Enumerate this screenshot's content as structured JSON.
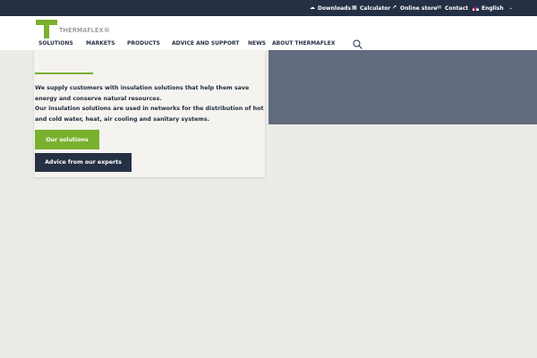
{
  "topbar": {
    "downloads": "Downloads",
    "calculator": "Calculator",
    "online_store": "Online store",
    "contact": "Contact",
    "language": "English"
  },
  "brand": {
    "name": "THERMAFLEX®",
    "green": "#79b12e",
    "navy": "#263044"
  },
  "nav": {
    "items": [
      {
        "label": "SOLUTIONS"
      },
      {
        "label": "MARKETS"
      },
      {
        "label": "PRODUCTS"
      },
      {
        "label": "ADVICE AND SUPPORT"
      },
      {
        "label": "NEWS"
      },
      {
        "label": "ABOUT THERMAFLEX"
      }
    ]
  },
  "hero": {
    "line1": "We supply customers with insulation solutions that help them save energy and conserve natural resources.",
    "line2": "Our insulation solutions are used in networks for the distribution of hot and cold water, heat, air cooling and sanitary systems.",
    "primary_cta": "Our solutions",
    "secondary_cta": "Advice from our experts"
  }
}
